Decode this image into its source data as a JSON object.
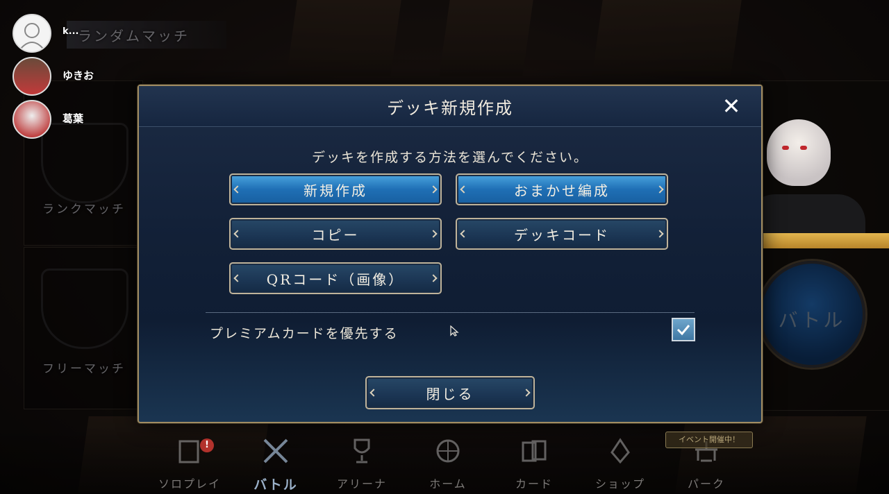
{
  "background": {
    "top_tab_label": "ランダムマッチ",
    "modes": [
      "ランクマッチ",
      "フリーマッチ"
    ],
    "battle_button": "バトル"
  },
  "participants": [
    {
      "name": "k..."
    },
    {
      "name": "ゆきお"
    },
    {
      "name": "葛葉"
    }
  ],
  "modal": {
    "title": "デッキ新規作成",
    "close_icon": "close-x",
    "subtitle": "デッキを作成する方法を選んでください。",
    "buttons": {
      "new": "新規作成",
      "auto": "おまかせ編成",
      "copy": "コピー",
      "deck_code": "デッキコード",
      "qr": "QRコード（画像）"
    },
    "option": {
      "label": "プレミアムカードを優先する",
      "checked": true
    },
    "close_button": "閉じる"
  },
  "bottom_nav": {
    "items": [
      {
        "label": "ソロプレイ",
        "icon": "solo-icon",
        "badge": "!"
      },
      {
        "label": "バトル",
        "icon": "crossed-swords-icon",
        "active": true
      },
      {
        "label": "アリーナ",
        "icon": "trophy-icon"
      },
      {
        "label": "ホーム",
        "icon": "compass-icon"
      },
      {
        "label": "カード",
        "icon": "cards-icon"
      },
      {
        "label": "ショップ",
        "icon": "shop-icon"
      },
      {
        "label": "パーク",
        "icon": "park-icon"
      }
    ],
    "event_badge": "イベント開催中！"
  },
  "colors": {
    "primary_button": "#2a86c9",
    "secondary_button": "#1f3a59",
    "modal_border": "#a08c62",
    "checkbox": "#5b93bd"
  }
}
